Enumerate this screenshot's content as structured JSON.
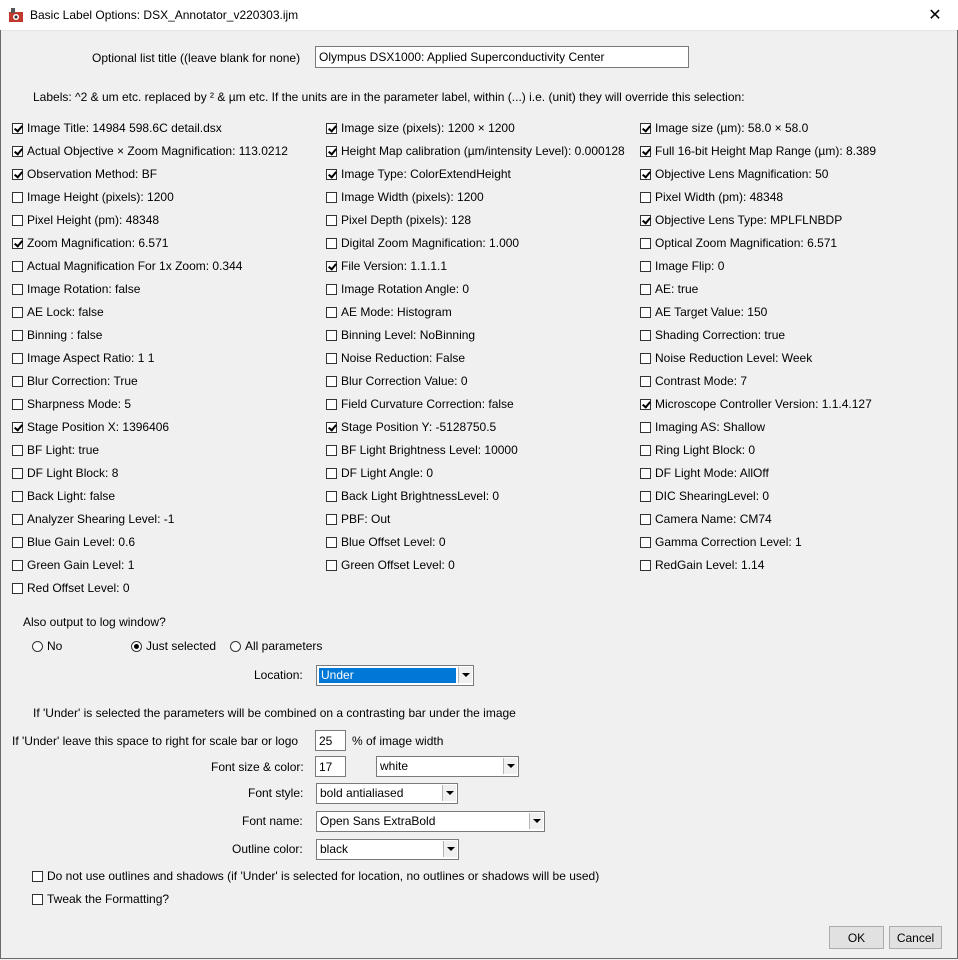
{
  "window": {
    "title": "Basic Label Options: DSX_Annotator_v220303.ijm",
    "close_glyph": "✕"
  },
  "list_title": {
    "label": "Optional list title ((leave blank for none)",
    "value": "Olympus DSX1000: Applied Superconductivity Center"
  },
  "labels_info": "Labels: ^2 & um etc. replaced by ² & µm etc. If the units are in the parameter label, within (...) i.e. (unit) they will override this selection:",
  "parameters": {
    "col1": [
      {
        "label": "Image Title: 14984 598.6C detail.dsx",
        "checked": true
      },
      {
        "label": "Actual Objective × Zoom Magnification: 113.0212",
        "checked": true
      },
      {
        "label": "Observation Method: BF",
        "checked": true
      },
      {
        "label": "Image Height (pixels): 1200",
        "checked": false
      },
      {
        "label": "Pixel Height (pm): 48348",
        "checked": false
      },
      {
        "label": "Zoom Magnification: 6.571",
        "checked": true
      },
      {
        "label": "Actual Magnification For 1x Zoom: 0.344",
        "checked": false
      },
      {
        "label": "Image Rotation: false",
        "checked": false
      },
      {
        "label": "AE Lock: false",
        "checked": false
      },
      {
        "label": "Binning : false",
        "checked": false
      },
      {
        "label": "Image Aspect Ratio:  1 1",
        "checked": false
      },
      {
        "label": "Blur Correction: True",
        "checked": false
      },
      {
        "label": "Sharpness Mode: 5",
        "checked": false
      },
      {
        "label": "Stage Position X: 1396406",
        "checked": true
      },
      {
        "label": "BF Light: true",
        "checked": false
      },
      {
        "label": "DF Light Block: 8",
        "checked": false
      },
      {
        "label": "Back Light: false",
        "checked": false
      },
      {
        "label": "Analyzer Shearing Level: -1",
        "checked": false
      },
      {
        "label": "Blue Gain Level: 0.6",
        "checked": false
      },
      {
        "label": "Green Gain Level: 1",
        "checked": false
      },
      {
        "label": "Red Offset Level: 0",
        "checked": false
      }
    ],
    "col2": [
      {
        "label": "Image size (pixels): 1200 × 1200",
        "checked": true
      },
      {
        "label": "Height Map calibration (µm/intensity Level): 0.000128",
        "checked": true
      },
      {
        "label": "Image Type: ColorExtendHeight",
        "checked": true
      },
      {
        "label": "Image Width (pixels): 1200",
        "checked": false
      },
      {
        "label": "Pixel Depth (pixels): 128",
        "checked": false
      },
      {
        "label": "Digital Zoom Magnification: 1.000",
        "checked": false
      },
      {
        "label": "File Version: 1.1.1.1",
        "checked": true
      },
      {
        "label": "Image Rotation Angle: 0",
        "checked": false
      },
      {
        "label": "AE Mode: Histogram",
        "checked": false
      },
      {
        "label": "Binning Level: NoBinning",
        "checked": false
      },
      {
        "label": "Noise Reduction: False",
        "checked": false
      },
      {
        "label": "Blur Correction Value: 0",
        "checked": false
      },
      {
        "label": "Field Curvature Correction: false",
        "checked": false
      },
      {
        "label": "Stage Position Y: -5128750.5",
        "checked": true
      },
      {
        "label": "BF Light Brightness Level: 10000",
        "checked": false
      },
      {
        "label": "DF Light Angle: 0",
        "checked": false
      },
      {
        "label": "Back Light BrightnessLevel: 0",
        "checked": false
      },
      {
        "label": "PBF: Out",
        "checked": false
      },
      {
        "label": "Blue Offset Level: 0",
        "checked": false
      },
      {
        "label": "Green Offset Level: 0",
        "checked": false
      }
    ],
    "col3": [
      {
        "label": "Image size (µm): 58.0 × 58.0",
        "checked": true
      },
      {
        "label": "Full 16-bit Height Map Range (µm): 8.389",
        "checked": true
      },
      {
        "label": "Objective Lens Magnification: 50",
        "checked": true
      },
      {
        "label": "Pixel Width  (pm): 48348",
        "checked": false
      },
      {
        "label": "Objective Lens Type: MPLFLNBDP",
        "checked": true
      },
      {
        "label": "Optical Zoom Magnification: 6.571",
        "checked": false
      },
      {
        "label": "Image Flip: 0",
        "checked": false
      },
      {
        "label": "AE: true",
        "checked": false
      },
      {
        "label": "AE Target Value: 150",
        "checked": false
      },
      {
        "label": "Shading Correction: true",
        "checked": false
      },
      {
        "label": "Noise Reduction Level: Week",
        "checked": false
      },
      {
        "label": "Contrast Mode: 7",
        "checked": false
      },
      {
        "label": "Microscope Controller Version: 1.1.4.127",
        "checked": true
      },
      {
        "label": "Imaging AS: Shallow",
        "checked": false
      },
      {
        "label": "Ring Light Block: 0",
        "checked": false
      },
      {
        "label": "DF Light Mode: AllOff",
        "checked": false
      },
      {
        "label": "DIC ShearingLevel: 0",
        "checked": false
      },
      {
        "label": "Camera Name: CM74",
        "checked": false
      },
      {
        "label": "Gamma Correction Level: 1",
        "checked": false
      },
      {
        "label": "RedGain Level: 1.14",
        "checked": false
      }
    ]
  },
  "log_output": {
    "question": "Also output to log window?",
    "options": [
      {
        "label": "No",
        "selected": false
      },
      {
        "label": "Just selected",
        "selected": true
      },
      {
        "label": "All parameters",
        "selected": false
      }
    ]
  },
  "location": {
    "label": "Location:",
    "value": "Under"
  },
  "under_note": "If 'Under' is selected the parameters will be combined on a contrasting bar under the image",
  "scale_space": {
    "label": "If 'Under' leave this space to right for scale bar or logo",
    "value": "25",
    "suffix": "% of image width"
  },
  "font_size_color": {
    "label": "Font size & color:",
    "size": "17",
    "color": "white"
  },
  "font_style": {
    "label": "Font style:",
    "value": "bold antialiased"
  },
  "font_name": {
    "label": "Font name:",
    "value": "Open Sans ExtraBold"
  },
  "outline_color": {
    "label": "Outline color:",
    "value": "black"
  },
  "no_outlines": {
    "label": "Do not use outlines and shadows (if 'Under' is selected for location, no outlines or shadows will be used)",
    "checked": false
  },
  "tweak_formatting": {
    "label": "Tweak the Formatting?",
    "checked": false
  },
  "buttons": {
    "ok": "OK",
    "cancel": "Cancel"
  },
  "colors": {
    "dialog_bg": "#f0f0f0",
    "selection": "#0078d7"
  }
}
